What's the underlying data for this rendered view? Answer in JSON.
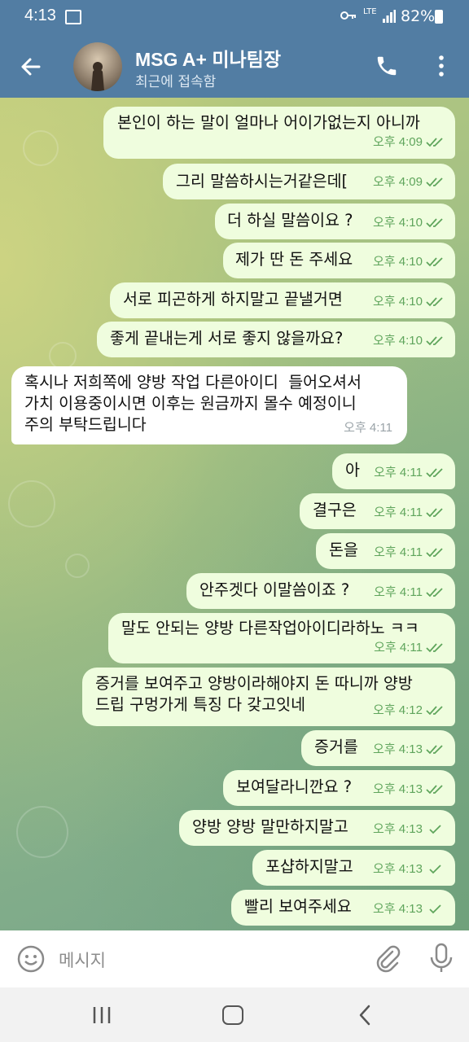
{
  "status_bar": {
    "time": "4:13",
    "battery": "82%",
    "network": "LTE"
  },
  "header": {
    "title": "MSG A+ 미나팀장",
    "subtitle": "최근에 접속함"
  },
  "messages": [
    {
      "text": "본인이 하는 말이 얼마나 어이가없는지 아니까",
      "time": "오후 4:09",
      "dir": "out",
      "read": true
    },
    {
      "text": "그리 말씀하시는거같은데[",
      "time": "오후 4:09",
      "dir": "out",
      "read": true
    },
    {
      "text": "더 하실 말씀이요 ?",
      "time": "오후 4:10",
      "dir": "out",
      "read": true
    },
    {
      "text": "제가 딴 돈 주세요",
      "time": "오후 4:10",
      "dir": "out",
      "read": true
    },
    {
      "text": "서로 피곤하게 하지말고 끝낼거면",
      "time": "오후 4:10",
      "dir": "out",
      "read": true
    },
    {
      "text": "좋게 끝내는게 서로 좋지 않을까요?",
      "time": "오후 4:10",
      "dir": "out",
      "read": true
    },
    {
      "text": "혹시나 저희쪽에 양방 작업 다른아이디  들어오셔서\n가치 이용중이시면 이후는 원금까지 몰수 예정이니\n주의 부탁드립니다",
      "time": "오후 4:11",
      "dir": "in"
    },
    {
      "text": "아",
      "time": "오후 4:11",
      "dir": "out",
      "read": true
    },
    {
      "text": "결구은",
      "time": "오후 4:11",
      "dir": "out",
      "read": true
    },
    {
      "text": "돈을",
      "time": "오후 4:11",
      "dir": "out",
      "read": true
    },
    {
      "text": "안주겟다 이말씀이죠 ?",
      "time": "오후 4:11",
      "dir": "out",
      "read": true
    },
    {
      "text": "말도 안되는 양방 다른작업아이디라하노 ㅋㅋ",
      "time": "오후 4:11",
      "dir": "out",
      "read": true
    },
    {
      "text": "증거를 보여주고 양방이라해야지 돈 따니까 양방\n드립 구멍가게 특징 다 갖고잇네",
      "time": "오후 4:12",
      "dir": "out",
      "read": true
    },
    {
      "text": "증거를",
      "time": "오후 4:13",
      "dir": "out",
      "read": true
    },
    {
      "text": "보여달라니깐요 ?",
      "time": "오후 4:13",
      "dir": "out",
      "read": true
    },
    {
      "text": "양방 양방 말만하지말고",
      "time": "오후 4:13",
      "dir": "out",
      "read": false
    },
    {
      "text": "포샵하지말고",
      "time": "오후 4:13",
      "dir": "out",
      "read": false
    },
    {
      "text": "빨리 보여주세요",
      "time": "오후 4:13",
      "dir": "out",
      "read": false
    }
  ],
  "input": {
    "placeholder": "메시지"
  },
  "colors": {
    "header": "#527da3",
    "outgoing_bubble": "#effdde",
    "incoming_bubble": "#ffffff",
    "check": "#5fa55c"
  }
}
